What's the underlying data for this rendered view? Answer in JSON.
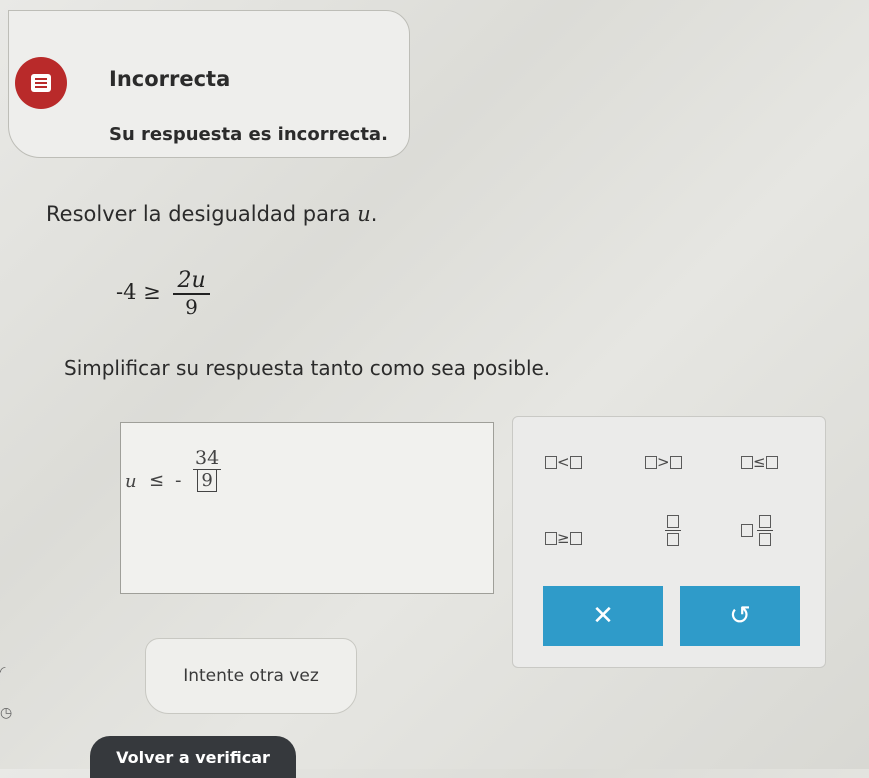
{
  "feedback": {
    "title": "Incorrecta",
    "message": "Su respuesta es incorrecta.",
    "icon": "document-icon",
    "icon_color": "#b92a2a"
  },
  "question": {
    "prompt_text": "Resolver la desigualdad para ",
    "variable": "u",
    "prompt_end": ".",
    "lhs": "-4",
    "relation": "≥",
    "rhs_numerator": "2u",
    "rhs_denominator": "9",
    "instruction": "Simplificar su respuesta tanto como sea posible."
  },
  "answer": {
    "variable": "u",
    "relation": "≤",
    "sign": "-",
    "numerator": "34",
    "denominator": "9"
  },
  "palette": {
    "less_than": "<",
    "greater_than": ">",
    "less_equal": "≤",
    "greater_equal": "≥"
  },
  "buttons": {
    "clear": "✕",
    "undo": "↺",
    "retry": "Intente otra vez",
    "check": "Volver a verificar"
  },
  "colors": {
    "action_blue": "#2f9bc9",
    "dark_button": "#36393d"
  }
}
